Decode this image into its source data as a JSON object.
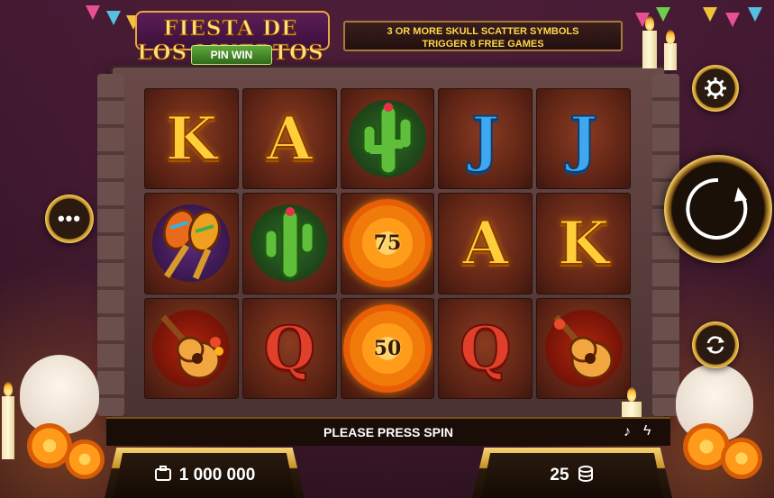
{
  "game": {
    "title": "FIESTA DE LOS MUERTOS",
    "subtitle": "PIN WIN"
  },
  "info_banner": {
    "line1": "3 OR MORE SKULL SCATTER SYMBOLS",
    "line2": "TRIGGER 8 FREE GAMES"
  },
  "reels": [
    [
      "K",
      "A",
      "cactus",
      "J",
      "J"
    ],
    [
      "maracas",
      "cactus",
      "flower-75",
      "A",
      "K"
    ],
    [
      "guitar",
      "Q",
      "flower-50",
      "Q",
      "guitar"
    ]
  ],
  "flower_values": {
    "r1c2": "75",
    "r2c2": "50"
  },
  "status_text": "PLEASE PRESS SPIN",
  "balance": {
    "value": "1 000 000",
    "icon": "wallet-icon"
  },
  "bet": {
    "value": "25",
    "icon": "coins-icon"
  },
  "buttons": {
    "settings": "gear-icon",
    "menu": "more-icon",
    "spin": "spin-icon",
    "autoplay": "autoplay-icon",
    "sound": "music-note-icon",
    "turbo": "lightning-icon"
  },
  "colors": {
    "gold": "#ffcf3a",
    "blue": "#3fa6f0",
    "red": "#e0402a",
    "panel_gold": "#f1c95a"
  }
}
